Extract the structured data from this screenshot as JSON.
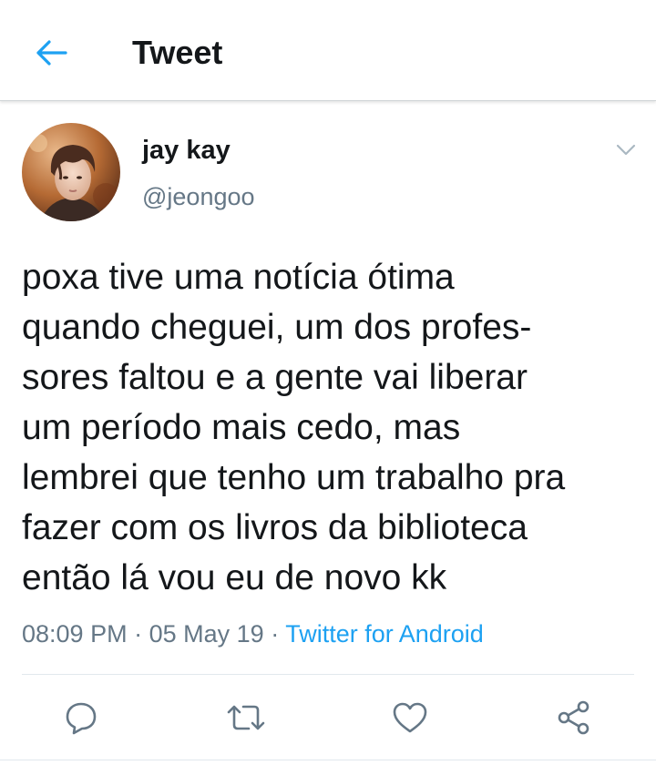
{
  "header": {
    "title": "Tweet",
    "back_icon": "arrow-left-icon",
    "accent": "#1da1f2"
  },
  "tweet": {
    "author": {
      "display_name": "jay kay",
      "handle": "@jeongoo",
      "avatar_icon": "avatar-photo"
    },
    "menu_icon": "chevron-down-icon",
    "text": "poxa tive uma notícia ótima\nquando cheguei, um dos profes-\nsores faltou e a gente vai liberar\num período mais cedo, mas\nlembrei que tenho um trabalho pra\nfazer com os livros da biblioteca\nentão lá vou eu de novo kk",
    "time": "08:09 PM",
    "date": "05 May 19",
    "separator": "·",
    "source": "Twitter for Android"
  },
  "actions": [
    {
      "name": "reply",
      "icon": "reply-icon"
    },
    {
      "name": "retweet",
      "icon": "retweet-icon"
    },
    {
      "name": "like",
      "icon": "heart-icon"
    },
    {
      "name": "share",
      "icon": "share-icon"
    }
  ],
  "colors": {
    "text": "#14171a",
    "secondary": "#657786",
    "link": "#1da1f2",
    "icon": "#657786",
    "divider": "#e1e8ed"
  }
}
